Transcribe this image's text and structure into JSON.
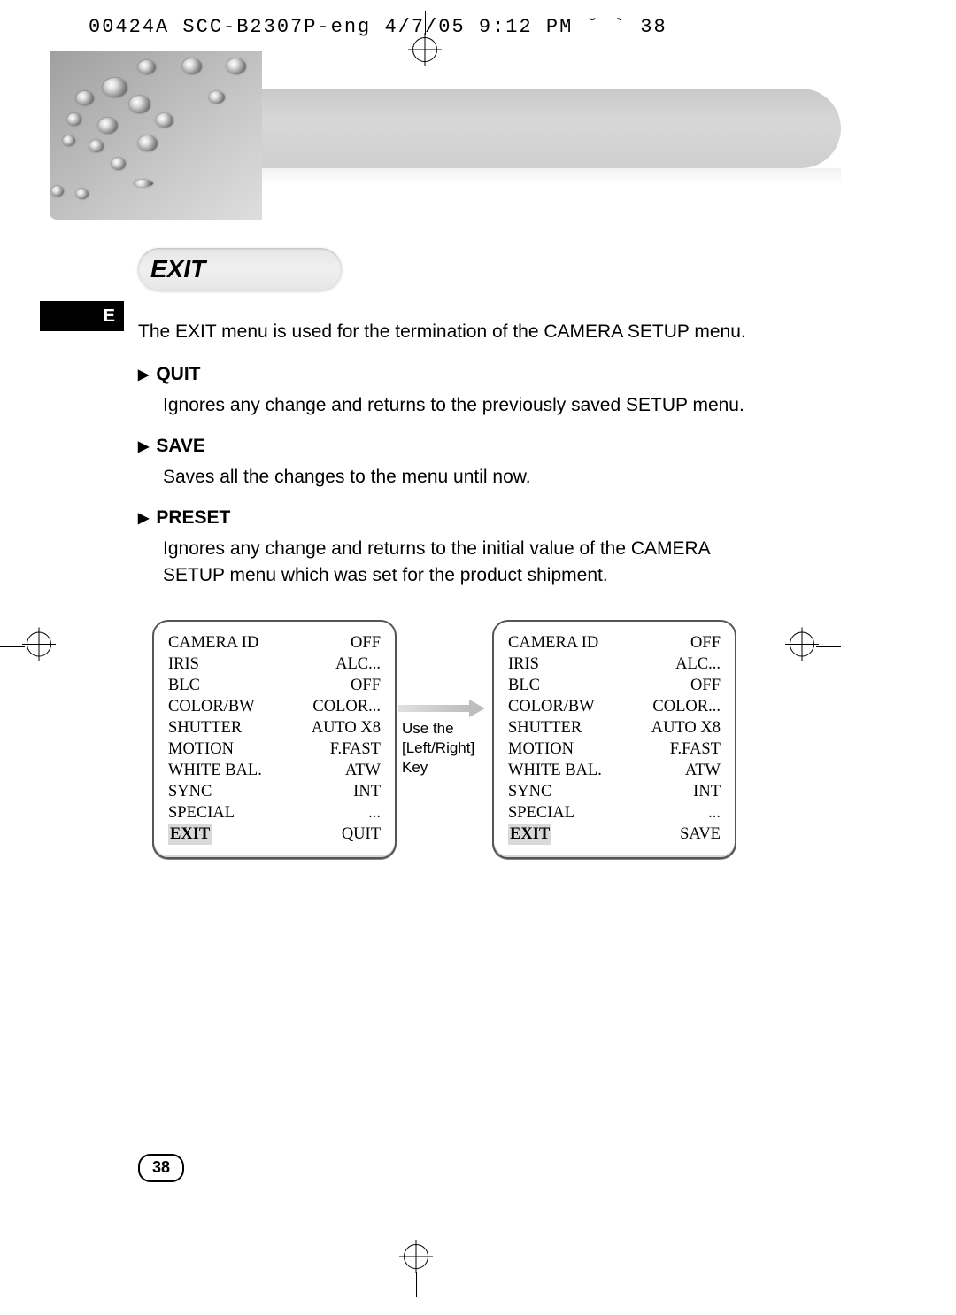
{
  "print_header": "00424A SCC-B2307P-eng 4/7/05 9:12 PM ˘ ` 38",
  "title": "EXIT",
  "lang_tab": "E",
  "intro": "The EXIT menu is used for the termination of the CAMERA SETUP menu.",
  "items": [
    {
      "head": "QUIT",
      "desc": "Ignores any change and returns to the previously saved SETUP menu."
    },
    {
      "head": "SAVE",
      "desc": "Saves all the changes to the menu until now."
    },
    {
      "head": "PRESET",
      "desc": "Ignores any change and returns to the initial value of the CAMERA SETUP menu which was set for the product shipment."
    }
  ],
  "arrow_hint": {
    "l1": "Use the",
    "l2": "[Left/Right]",
    "l3": "Key"
  },
  "menu_rows": [
    {
      "label": "CAMERA ID",
      "value": "OFF"
    },
    {
      "label": "IRIS",
      "value": "ALC..."
    },
    {
      "label": "BLC",
      "value": "OFF"
    },
    {
      "label": "COLOR/BW",
      "value": "COLOR..."
    },
    {
      "label": "SHUTTER",
      "value": "AUTO X8"
    },
    {
      "label": "MOTION",
      "value": "F.FAST"
    },
    {
      "label": "WHITE BAL.",
      "value": "ATW"
    },
    {
      "label": "SYNC",
      "value": "INT"
    },
    {
      "label": "SPECIAL",
      "value": "..."
    }
  ],
  "exit_label": "EXIT",
  "exit_left_value": "QUIT",
  "exit_right_value": "SAVE",
  "page_number": "38"
}
